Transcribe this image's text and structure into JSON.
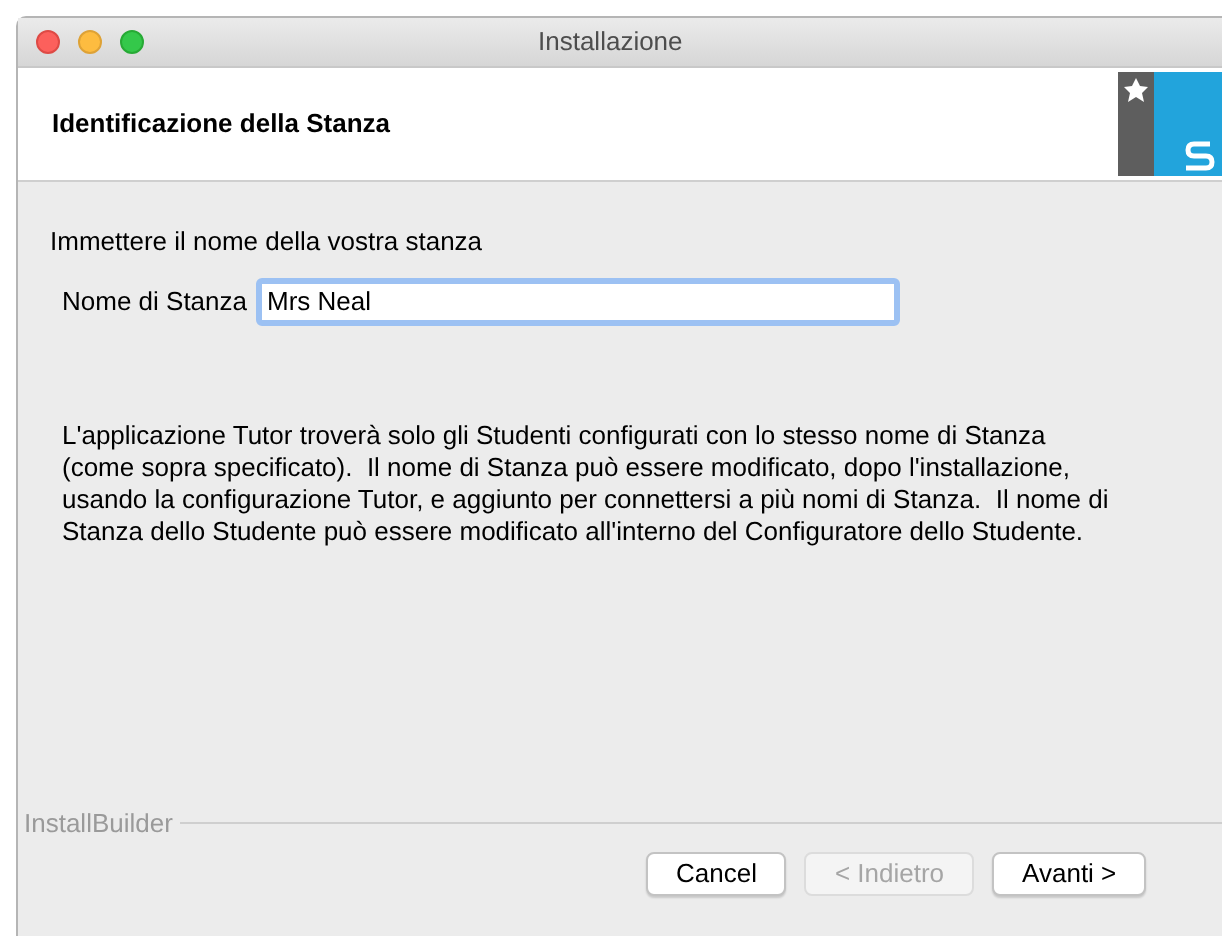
{
  "window": {
    "title": "Installazione"
  },
  "header": {
    "title": "Identificazione della Stanza"
  },
  "prompt": "Immettere il nome della vostra stanza",
  "field": {
    "label": "Nome di Stanza",
    "value": "Mrs Neal"
  },
  "description": "L'applicazione Tutor troverà solo gli Studenti configurati con lo stesso nome di Stanza (come sopra specificato).  Il nome di Stanza può essere modificato, dopo l'installazione, usando la configurazione Tutor, e aggiunto per connettersi a più nomi di Stanza.  Il nome di Stanza dello Studente può essere modificato all'interno del Configuratore dello Studente.",
  "footer": {
    "brand": "InstallBuilder"
  },
  "buttons": [
    {
      "label": "Cancel",
      "disabled": false
    },
    {
      "label": "< Indietro",
      "disabled": true
    },
    {
      "label": "Avanti >",
      "disabled": false
    }
  ]
}
